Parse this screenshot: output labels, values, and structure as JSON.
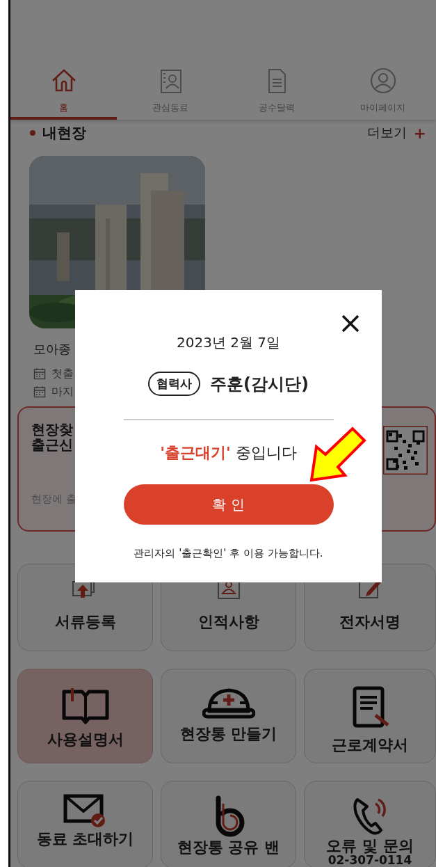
{
  "tabs": [
    {
      "label": "홈",
      "selected": true
    },
    {
      "label": "관심동료",
      "selected": false
    },
    {
      "label": "공수달력",
      "selected": false
    },
    {
      "label": "마이페이지",
      "selected": false
    }
  ],
  "my_sites": {
    "title": "내현장",
    "more": "더보기",
    "more_icon": "+",
    "site": {
      "name": "모아종",
      "dates": [
        "첫출",
        "마지"
      ]
    }
  },
  "checkin_card": {
    "lines": [
      "현장찾",
      "출근신"
    ],
    "hint": "현장에 출"
  },
  "menu_tiles": [
    {
      "lines": [
        "서류등록"
      ],
      "highlighted": false
    },
    {
      "lines": [
        "인적사항"
      ],
      "highlighted": false
    },
    {
      "lines": [
        "전자서명"
      ],
      "highlighted": false
    },
    {
      "lines": [
        "사용설명서"
      ],
      "highlighted": true
    },
    {
      "lines": [
        "현장통 만들기"
      ],
      "highlighted": false
    },
    {
      "lines": [
        "근로계약서"
      ],
      "highlighted": false
    },
    {
      "lines": [
        "동료 초대하기"
      ],
      "highlighted": false
    },
    {
      "lines": [
        "현장통 공유 밴"
      ],
      "highlighted": false
    },
    {
      "lines": [
        "오류 및 문의",
        "02-307-0114"
      ],
      "highlighted": false
    }
  ],
  "dialog": {
    "date": "2023년 2월 7일",
    "role": "협력사",
    "name": "주훈(감시단)",
    "status": {
      "highlight": "'출근대기'",
      "rest": "중입니다"
    },
    "button": "확 인",
    "note": "관리자의 '출근확인' 후 이용 가능합니다."
  }
}
